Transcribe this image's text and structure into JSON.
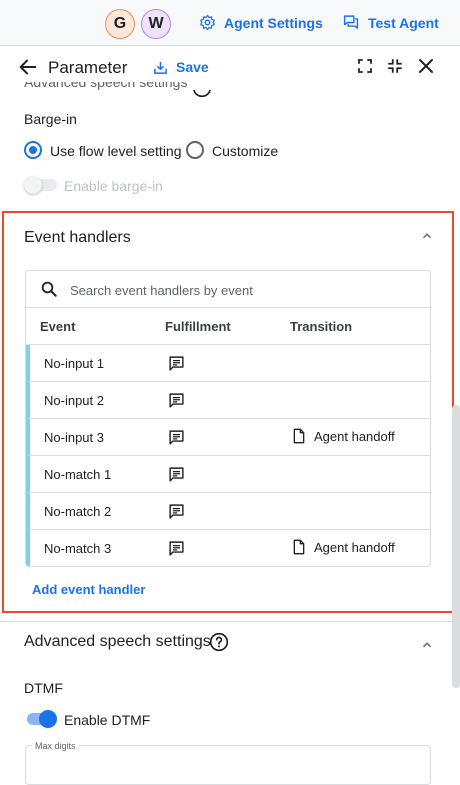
{
  "topbar": {
    "avatars": [
      "G",
      "W"
    ],
    "agent_settings": "Agent Settings",
    "test_agent": "Test Agent"
  },
  "panel": {
    "title": "Parameter",
    "save": "Save"
  },
  "barge_in": {
    "cut_heading": "Advanced speech settings",
    "title": "Barge-in",
    "option_flow": "Use flow level setting",
    "option_customize": "Customize",
    "selected": "Use flow level setting",
    "toggle_label": "Enable barge-in",
    "toggle_on": false
  },
  "event_handlers": {
    "title": "Event handlers",
    "search_placeholder": "Search event handlers by event",
    "columns": {
      "event": "Event",
      "fulfillment": "Fulfillment",
      "transition": "Transition"
    },
    "rows": [
      {
        "event": "No-input 1",
        "fulfillment_icon": "message-icon",
        "transition": ""
      },
      {
        "event": "No-input 2",
        "fulfillment_icon": "message-icon",
        "transition": ""
      },
      {
        "event": "No-input 3",
        "fulfillment_icon": "message-icon",
        "transition": "Agent handoff"
      },
      {
        "event": "No-match 1",
        "fulfillment_icon": "message-icon",
        "transition": ""
      },
      {
        "event": "No-match 2",
        "fulfillment_icon": "message-icon",
        "transition": ""
      },
      {
        "event": "No-match 3",
        "fulfillment_icon": "message-icon",
        "transition": "Agent handoff"
      }
    ],
    "add_label": "Add event handler"
  },
  "advanced_speech": {
    "title": "Advanced speech settings",
    "dtmf_title": "DTMF",
    "dtmf_toggle_label": "Enable DTMF",
    "dtmf_toggle_on": true,
    "max_digits_label": "Max digits"
  },
  "colors": {
    "accent": "#1a73e8",
    "highlight_border": "#ea4c2a",
    "row_marker": "#7cd0ea"
  }
}
